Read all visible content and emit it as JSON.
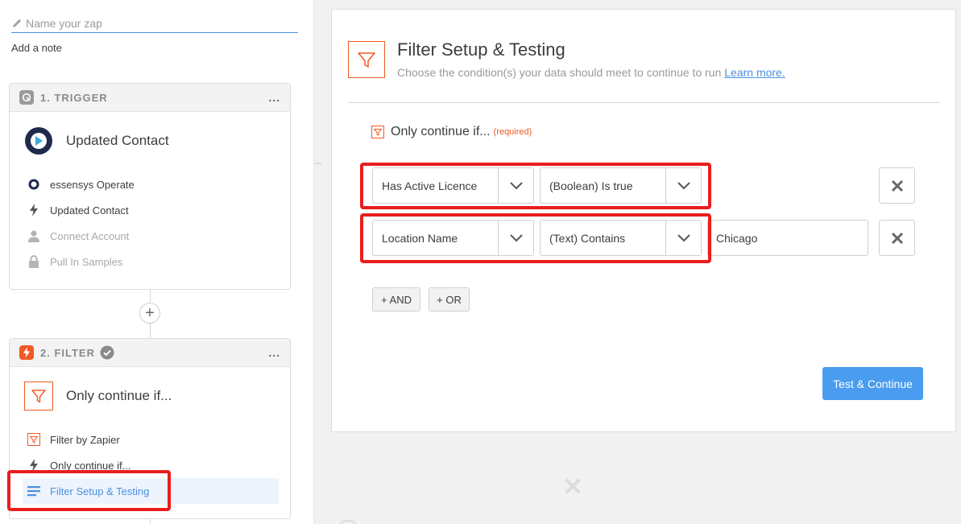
{
  "zap": {
    "name_placeholder": "Name your zap",
    "add_note": "Add a note"
  },
  "trigger_step": {
    "header": "1. TRIGGER",
    "menu": "...",
    "title": "Updated Contact",
    "items": [
      {
        "label": "essensys Operate",
        "icon": "essensys-app-icon",
        "muted": false
      },
      {
        "label": "Updated Contact",
        "icon": "bolt-icon",
        "muted": false
      },
      {
        "label": "Connect Account",
        "icon": "user-icon",
        "muted": true
      },
      {
        "label": "Pull In Samples",
        "icon": "lock-icon",
        "muted": true
      }
    ]
  },
  "add_step": "+",
  "filter_step": {
    "header": "2. FILTER",
    "menu": "...",
    "title": "Only continue if...",
    "items": [
      {
        "label": "Filter by Zapier",
        "icon": "filter-icon"
      },
      {
        "label": "Only continue if...",
        "icon": "bolt-icon"
      },
      {
        "label": "Filter Setup & Testing",
        "icon": "list-icon",
        "active": true
      }
    ]
  },
  "panel": {
    "title": "Filter Setup & Testing",
    "subtitle": "Choose the condition(s) your data should meet to continue to run",
    "learn_more": "Learn more.",
    "only_continue": "Only continue if...",
    "required": "(required)",
    "conditions": [
      {
        "field": "Has Active Licence",
        "operator": "(Boolean) Is true",
        "value": ""
      },
      {
        "field": "Location Name",
        "operator": "(Text) Contains",
        "value": "Chicago"
      }
    ],
    "and_button": "+ AND",
    "or_button": "+ OR",
    "submit": "Test & Continue"
  },
  "colors": {
    "accent": "#4a90e2",
    "brand_orange": "#f05a22",
    "highlight_red": "#ea1d1d",
    "primary_button": "#4a9cf0"
  }
}
